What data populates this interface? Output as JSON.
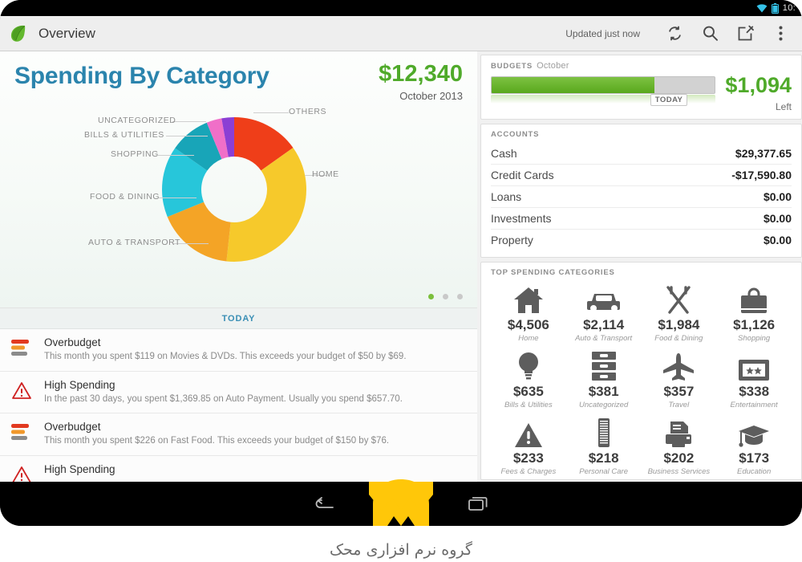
{
  "statusbar": {
    "time": "10:",
    "wifi_icon": "wifi-icon",
    "battery_icon": "battery-icon"
  },
  "actionbar": {
    "app_icon": "leaf-logo-icon",
    "title": "Overview",
    "updated": "Updated just now",
    "refresh_icon": "refresh-icon",
    "search_icon": "search-icon",
    "compose_icon": "compose-icon",
    "overflow_icon": "overflow-menu-icon"
  },
  "spending": {
    "title": "Spending By Category",
    "amount": "$12,340",
    "month": "October 2013",
    "pager": {
      "count": 3,
      "active": 0
    }
  },
  "chart_data": {
    "type": "pie",
    "title": "Spending By Category",
    "subtitle": "October 2013",
    "total": "$12,340",
    "legend_position": "around",
    "categories": [
      "Home",
      "Auto & Transport",
      "Food & Dining",
      "Shopping",
      "Bills & Utilities",
      "Uncategorized",
      "Others"
    ],
    "labels": [
      "OTHERS",
      "HOME",
      "AUTO & TRANSPORT",
      "FOOD & DINING",
      "SHOPPING",
      "BILLS & UTILITIES",
      "UNCATEGORIZED"
    ],
    "slices": [
      {
        "label": "HOME",
        "value": 36.5,
        "color": "#f6c92b"
      },
      {
        "label": "AUTO & TRANSPORT",
        "value": 17.1,
        "color": "#f4a426"
      },
      {
        "label": "FOOD & DINING",
        "value": 15.9,
        "color": "#27c6da"
      },
      {
        "label": "SHOPPING",
        "value": 9.1,
        "color": "#18a5b8"
      },
      {
        "label": "BILLS & UTILITIES",
        "value": 3.4,
        "color": "#f06fc8"
      },
      {
        "label": "UNCATEGORIZED",
        "value": 2.8,
        "color": "#8b3fd4"
      },
      {
        "label": "OTHERS",
        "value": 15.2,
        "color": "#ef3e19"
      }
    ]
  },
  "today_divider": "TODAY",
  "alerts": [
    {
      "icon": "overbudget-bars-icon",
      "title": "Overbudget",
      "desc": "This month you spent $119 on Movies & DVDs. This exceeds your budget of $50 by $69."
    },
    {
      "icon": "warning-triangle-icon",
      "title": "High Spending",
      "desc": "In the past 30 days, you spent $1,369.85 on Auto Payment.  Usually you spend $657.70."
    },
    {
      "icon": "overbudget-bars-icon",
      "title": "Overbudget",
      "desc": "This month you spent $226 on Fast Food. This exceeds your budget of $150 by $76."
    },
    {
      "icon": "warning-triangle-icon",
      "title": "High Spending",
      "desc": ""
    }
  ],
  "budgets": {
    "header": "BUDGETS",
    "month": "October",
    "progress_percent": 73,
    "today_marker": "TODAY",
    "amount": "$1,094",
    "amount_caption": "Left",
    "accent_color": "#4faa2a"
  },
  "accounts": {
    "header": "ACCOUNTS",
    "rows": [
      {
        "name": "Cash",
        "value": "$29,377.65"
      },
      {
        "name": "Credit Cards",
        "value": "-$17,590.80"
      },
      {
        "name": "Loans",
        "value": "$0.00"
      },
      {
        "name": "Investments",
        "value": "$0.00"
      },
      {
        "name": "Property",
        "value": "$0.00"
      }
    ]
  },
  "top_categories": {
    "header": "TOP SPENDING CATEGORIES",
    "items": [
      {
        "icon": "house-icon",
        "amount": "$4,506",
        "name": "Home"
      },
      {
        "icon": "car-icon",
        "amount": "$2,114",
        "name": "Auto & Transport"
      },
      {
        "icon": "fork-knife-icon",
        "amount": "$1,984",
        "name": "Food & Dining"
      },
      {
        "icon": "shopping-bag-icon",
        "amount": "$1,126",
        "name": "Shopping"
      },
      {
        "icon": "lightbulb-icon",
        "amount": "$635",
        "name": "Bills & Utilities"
      },
      {
        "icon": "file-drawers-icon",
        "amount": "$381",
        "name": "Uncategorized"
      },
      {
        "icon": "airplane-icon",
        "amount": "$357",
        "name": "Travel"
      },
      {
        "icon": "ticket-icon",
        "amount": "$338",
        "name": "Entertainment"
      },
      {
        "icon": "warning-triangle-icon",
        "amount": "$233",
        "name": "Fees & Charges"
      },
      {
        "icon": "comb-icon",
        "amount": "$218",
        "name": "Personal Care"
      },
      {
        "icon": "printer-icon",
        "amount": "$202",
        "name": "Business Services"
      },
      {
        "icon": "graduation-cap-icon",
        "amount": "$173",
        "name": "Education"
      }
    ]
  },
  "navbar": {
    "back_icon": "back-icon",
    "recents_icon": "recent-apps-icon"
  },
  "watermark": {
    "logo_icon": "makhak-logo-icon",
    "text": "گروه نرم افزاری محک",
    "color": "#ffc709"
  }
}
